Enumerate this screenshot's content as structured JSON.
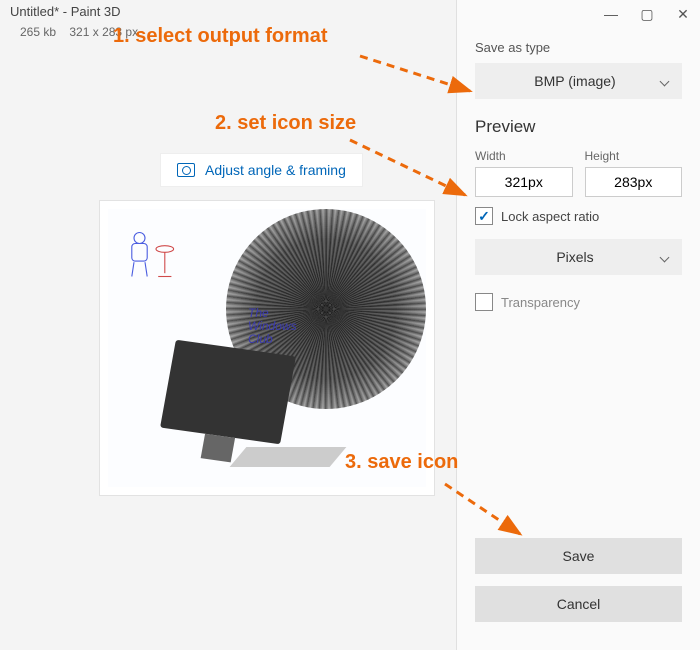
{
  "header": {
    "title": "Untitled* - Paint 3D",
    "filesize": "265 kb",
    "dimensions": "321 x 283 px"
  },
  "toolbar": {
    "adjust_label": "Adjust angle & framing"
  },
  "canvas": {
    "watermark_line1": "The",
    "watermark_line2": "Windows",
    "watermark_line3": "Club"
  },
  "panel": {
    "save_as_type_label": "Save as type",
    "format_value": "BMP (image)",
    "preview_label": "Preview",
    "width_label": "Width",
    "height_label": "Height",
    "width_value": "321px",
    "height_value": "283px",
    "lock_aspect_label": "Lock aspect ratio",
    "lock_aspect_checked": true,
    "units_value": "Pixels",
    "transparency_label": "Transparency",
    "transparency_checked": false,
    "save_label": "Save",
    "cancel_label": "Cancel"
  },
  "annotations": {
    "step1": "1. select output format",
    "step2": "2. set icon size",
    "step3": "3. save icon"
  }
}
